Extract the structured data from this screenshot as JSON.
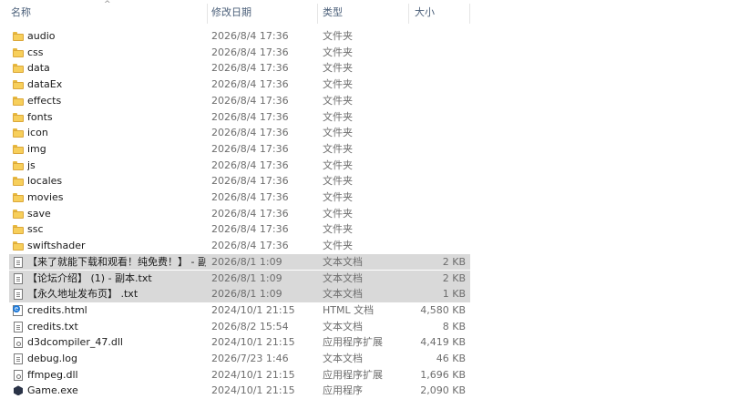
{
  "columns": {
    "name": "名称",
    "date": "修改日期",
    "type": "类型",
    "size": "大小"
  },
  "sort_indicator": "^",
  "files": [
    {
      "name": "audio",
      "date": "2026/8/4 17:36",
      "type": "文件夹",
      "size": "",
      "icon": "folder-icon",
      "selected": false
    },
    {
      "name": "css",
      "date": "2026/8/4 17:36",
      "type": "文件夹",
      "size": "",
      "icon": "folder-icon",
      "selected": false
    },
    {
      "name": "data",
      "date": "2026/8/4 17:36",
      "type": "文件夹",
      "size": "",
      "icon": "folder-icon",
      "selected": false
    },
    {
      "name": "dataEx",
      "date": "2026/8/4 17:36",
      "type": "文件夹",
      "size": "",
      "icon": "folder-icon",
      "selected": false
    },
    {
      "name": "effects",
      "date": "2026/8/4 17:36",
      "type": "文件夹",
      "size": "",
      "icon": "folder-icon",
      "selected": false
    },
    {
      "name": "fonts",
      "date": "2026/8/4 17:36",
      "type": "文件夹",
      "size": "",
      "icon": "folder-icon",
      "selected": false
    },
    {
      "name": "icon",
      "date": "2026/8/4 17:36",
      "type": "文件夹",
      "size": "",
      "icon": "folder-icon",
      "selected": false
    },
    {
      "name": "img",
      "date": "2026/8/4 17:36",
      "type": "文件夹",
      "size": "",
      "icon": "folder-icon",
      "selected": false
    },
    {
      "name": "js",
      "date": "2026/8/4 17:36",
      "type": "文件夹",
      "size": "",
      "icon": "folder-icon",
      "selected": false
    },
    {
      "name": "locales",
      "date": "2026/8/4 17:36",
      "type": "文件夹",
      "size": "",
      "icon": "folder-icon",
      "selected": false
    },
    {
      "name": "movies",
      "date": "2026/8/4 17:36",
      "type": "文件夹",
      "size": "",
      "icon": "folder-icon",
      "selected": false
    },
    {
      "name": "save",
      "date": "2026/8/4 17:36",
      "type": "文件夹",
      "size": "",
      "icon": "folder-icon",
      "selected": false
    },
    {
      "name": "ssc",
      "date": "2026/8/4 17:36",
      "type": "文件夹",
      "size": "",
      "icon": "folder-icon",
      "selected": false
    },
    {
      "name": "swiftshader",
      "date": "2026/8/4 17:36",
      "type": "文件夹",
      "size": "",
      "icon": "folder-icon",
      "selected": false
    },
    {
      "name": "【来了就能下载和观看！纯免费！】 - 副...",
      "date": "2026/8/1 1:09",
      "type": "文本文档",
      "size": "2 KB",
      "icon": "text-file-icon",
      "selected": true
    },
    {
      "name": "【论坛介绍】 (1) - 副本.txt",
      "date": "2026/8/1 1:09",
      "type": "文本文档",
      "size": "2 KB",
      "icon": "text-file-icon",
      "selected": true
    },
    {
      "name": "【永久地址发布页】 .txt",
      "date": "2026/8/1 1:09",
      "type": "文本文档",
      "size": "1 KB",
      "icon": "text-file-icon",
      "selected": true
    },
    {
      "name": "credits.html",
      "date": "2024/10/1 21:15",
      "type": "HTML 文档",
      "size": "4,580 KB",
      "icon": "html-file-icon",
      "selected": false
    },
    {
      "name": "credits.txt",
      "date": "2026/8/2 15:54",
      "type": "文本文档",
      "size": "8 KB",
      "icon": "text-file-icon",
      "selected": false
    },
    {
      "name": "d3dcompiler_47.dll",
      "date": "2024/10/1 21:15",
      "type": "应用程序扩展",
      "size": "4,419 KB",
      "icon": "dll-file-icon",
      "selected": false
    },
    {
      "name": "debug.log",
      "date": "2026/7/23 1:46",
      "type": "文本文档",
      "size": "46 KB",
      "icon": "text-file-icon",
      "selected": false
    },
    {
      "name": "ffmpeg.dll",
      "date": "2024/10/1 21:15",
      "type": "应用程序扩展",
      "size": "1,696 KB",
      "icon": "dll-file-icon",
      "selected": false
    },
    {
      "name": "Game.exe",
      "date": "2024/10/1 21:15",
      "type": "应用程序",
      "size": "2,090 KB",
      "icon": "exe-file-icon",
      "selected": false
    }
  ]
}
